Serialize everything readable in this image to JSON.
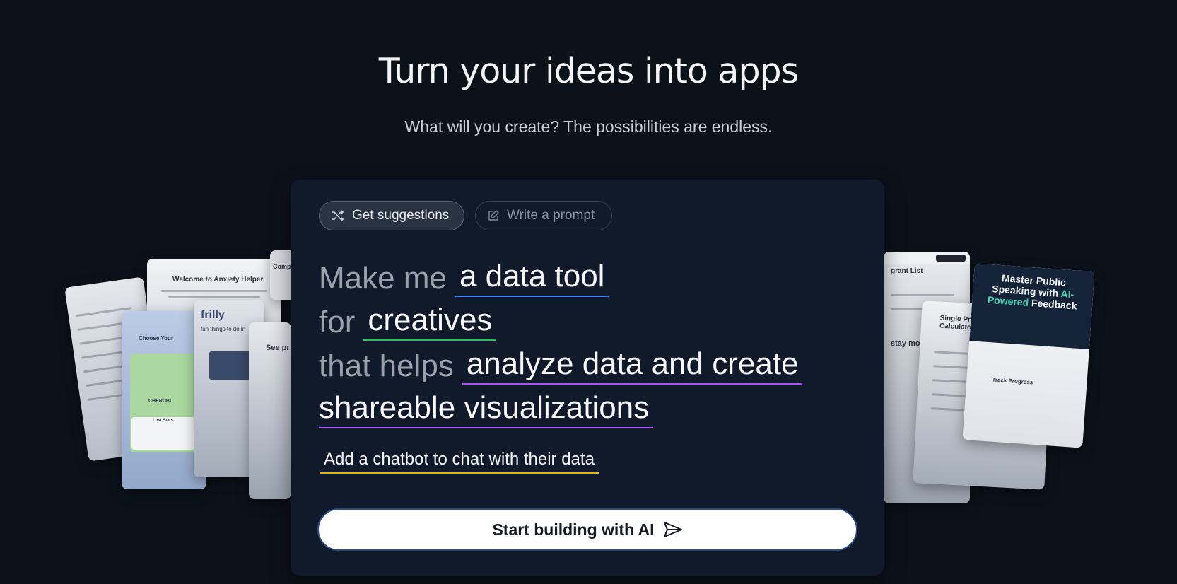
{
  "hero": {
    "title": "Turn your ideas into apps",
    "subtitle": "What will you create? The possibilities are endless."
  },
  "mode_tabs": [
    {
      "label": "Get suggestions",
      "icon": "shuffle-icon",
      "active": true
    },
    {
      "label": "Write a prompt",
      "icon": "edit-icon",
      "active": false
    }
  ],
  "prompt": {
    "make_me": "Make me",
    "app_type": "a data tool",
    "for": "for",
    "audience": "creatives",
    "that_helps": "that helps",
    "purpose_line1": "analyze data and create",
    "purpose_line2": "shareable visualizations",
    "extra_feature": "Add a chatbot to chat with their data"
  },
  "cta": {
    "label": "Start building with AI",
    "icon": "send-icon"
  },
  "gallery": {
    "left": [
      "Welcome to Anxiety Helper",
      "Choose Your",
      "CHERUBI",
      "Lost Stats",
      "frilly",
      "fun things to do in",
      "See pr",
      "Comp"
    ],
    "right": [
      "grant List",
      "stay motivated",
      "Single Property Loan Calculator",
      "Master Public Speaking with AI-Powered Feedback",
      "Track Progress"
    ]
  },
  "colors": {
    "page_bg": "#0b121a",
    "card_bg": "#111a2b",
    "underline_app_type": "#3b82f6",
    "underline_audience": "#22c55e",
    "underline_purpose": "#a855f7",
    "underline_extra": "#eab308",
    "accent_teal": "#43d6b5"
  }
}
